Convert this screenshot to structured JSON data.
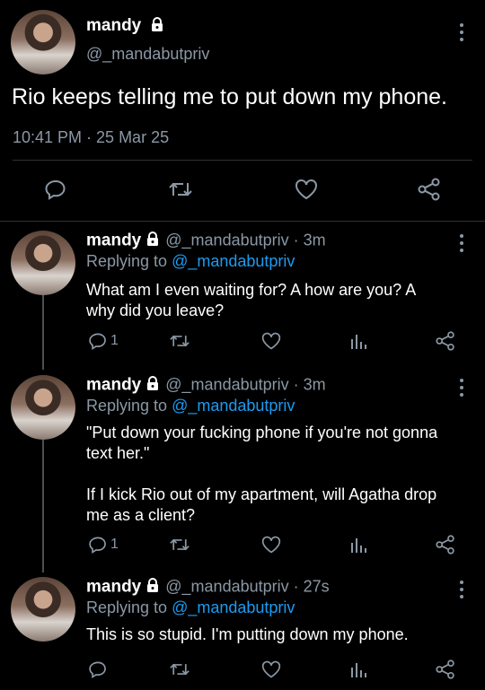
{
  "main": {
    "name": "mandy",
    "handle": "@_mandabutpriv",
    "text": "Rio keeps telling me to put down my phone.",
    "timestamp": "10:41 PM · 25 Mar 25"
  },
  "replies": [
    {
      "name": "mandy",
      "handle": "@_mandabutpriv",
      "time": "3m",
      "replying_prefix": "Replying to",
      "replying_to": "@_mandabutpriv",
      "body_lines": [
        "What am I even waiting for? A how are you? A",
        "why did you leave?"
      ],
      "reply_count": "1"
    },
    {
      "name": "mandy",
      "handle": "@_mandabutpriv",
      "time": "3m",
      "replying_prefix": "Replying to",
      "replying_to": "@_mandabutpriv",
      "body_lines": [
        "\"Put down your fucking phone if you're not gonna",
        "text her.\"",
        "",
        "If I kick Rio out of my apartment, will Agatha drop",
        "me as a client?"
      ],
      "reply_count": "1"
    },
    {
      "name": "mandy",
      "handle": "@_mandabutpriv",
      "time": "27s",
      "replying_prefix": "Replying to",
      "replying_to": "@_mandabutpriv",
      "body_lines": [
        "This is so stupid. I'm putting down my phone."
      ],
      "reply_count": ""
    }
  ],
  "icons": {
    "lock": "lock-icon",
    "reply": "speech-bubble-icon",
    "retweet": "retweet-icon",
    "like": "heart-icon",
    "analytics": "bar-chart-icon",
    "share": "share-icon",
    "more": "vertical-dots-icon"
  },
  "colors": {
    "background": "#000000",
    "link": "#1d9bf0",
    "muted": "#8b98a5",
    "text": "#e7e9ea"
  }
}
